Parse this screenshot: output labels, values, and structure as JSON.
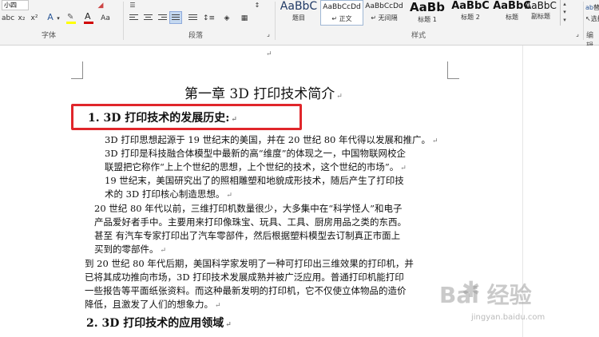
{
  "ribbon": {
    "font": {
      "size": "小四",
      "row1": [
        "abc",
        "x₂",
        "x²",
        "A",
        "A",
        "Aa"
      ],
      "group_label": "字体",
      "colors": {
        "highlight": "#ffff00",
        "font_color": "#d00000"
      }
    },
    "paragraph": {
      "group_label": "段落"
    },
    "styles": {
      "group_label": "样式",
      "items": [
        {
          "preview": "AaBbC",
          "name": "题目"
        },
        {
          "preview": "AaBbCcDd",
          "name": "↵ 正文"
        },
        {
          "preview": "AaBbCcDd",
          "name": "↵ 无间隔"
        },
        {
          "preview": "AaBb",
          "name": "标题 1"
        },
        {
          "preview": "AaBbC",
          "name": "标题 2"
        },
        {
          "preview": "AaBbC",
          "name": "标题"
        },
        {
          "preview": "AaBbC",
          "name": "副标题"
        }
      ]
    },
    "editing": {
      "items": [
        "替换",
        "选择"
      ],
      "group_label": "编辑"
    }
  },
  "document": {
    "title": "第一章 3D 打印技术简介",
    "heading1": "1.  3D 打印技术的发展历史:",
    "lines": [
      "3D 打印思想起源于 19 世纪末的美国，并在 20 世纪 80 年代得以发展和推广。",
      "3D 打印是科技融合体模型中最新的高“维度”的体现之一，中国物联网校企",
      "联盟把它称作“上上个世纪的思想，上个世纪的技术，这个世纪的市场”。",
      "19 世纪末，美国研究出了的照相雕塑和地貌成形技术，随后产生了打印技",
      "术的 3D 打印核心制造思想。",
      "20 世纪 80 年代以前，三维打印机数量很少，大多集中在“科学怪人”和电子",
      "产品爱好者手中。主要用来打印像珠宝、玩具、工具、厨房用品之类的东西。",
      "甚至    有汽车专家打印出了汽车零部件，然后根据塑料模型去订制真正市面上",
      "买到的零部件。",
      "到 20 世纪 80 年代后期，美国科学家发明了一种可打印出三维效果的打印机，并",
      "已将其成功推向市场，3D  打印技术发展成熟并被广泛应用。普通打印机能打印",
      "一些报告等平面纸张资料。而这种最新发明的打印机，它不仅使立体物品的造价",
      "降低，且激发了人们的想象力。"
    ],
    "heading2": "2.   3D 打印技术的应用领域",
    "mark": "↵"
  },
  "watermark": {
    "brand": "Bai 经验",
    "url": "jingyan.baidu.com"
  }
}
